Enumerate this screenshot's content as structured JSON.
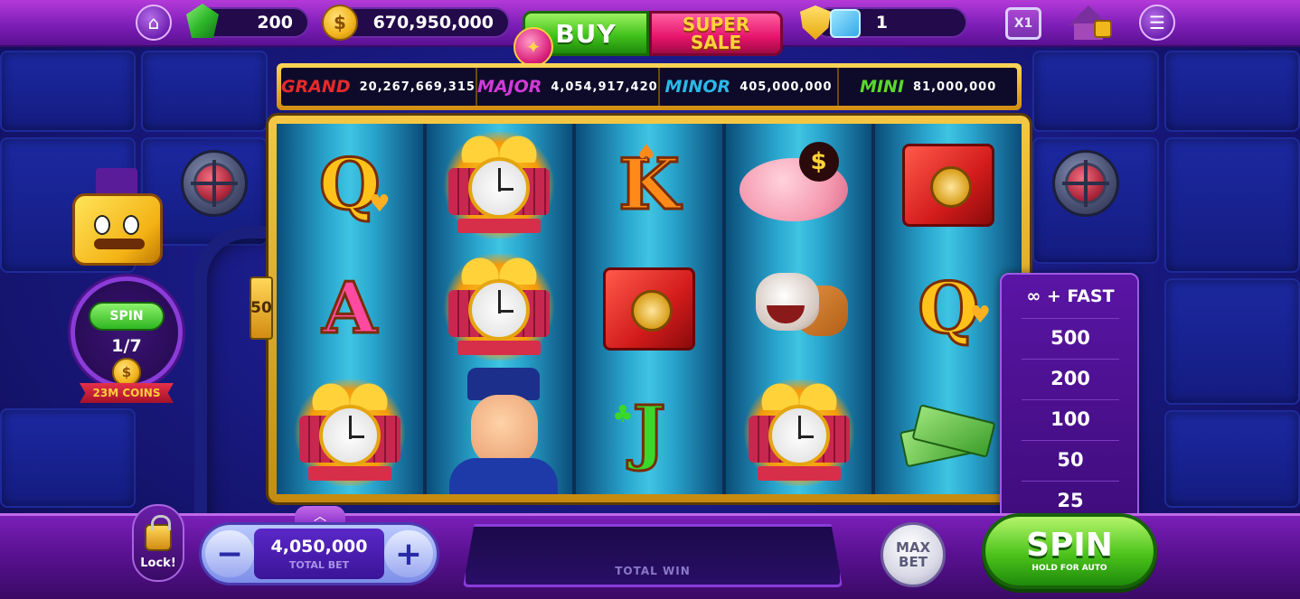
{
  "topbar": {
    "gems": "200",
    "coins": "670,950,000",
    "buy_label": "BUY",
    "sale_line1": "SUPER",
    "sale_line2": "SALE",
    "boost_count": "1",
    "multiplier": "X1",
    "icons": [
      "home-icon",
      "gem-icon",
      "coin-icon",
      "gift-icon",
      "shield-icon",
      "snowflake-icon",
      "multiplier-icon",
      "locked-house-icon",
      "menu-icon"
    ]
  },
  "jackpots": [
    {
      "name": "GRAND",
      "value": "20,267,669,315",
      "color": "#e82a2a"
    },
    {
      "name": "MAJOR",
      "value": "4,054,917,420",
      "color": "#d23ad8"
    },
    {
      "name": "MINOR",
      "value": "405,000,000",
      "color": "#2ab8e8"
    },
    {
      "name": "MINI",
      "value": "81,000,000",
      "color": "#5ad82a"
    }
  ],
  "reels": [
    [
      "Q",
      "clock",
      "A"
    ],
    [
      "clock",
      "clock",
      "police"
    ],
    [
      "K",
      "safe",
      "J"
    ],
    [
      "piggy-bank",
      "bulldog",
      "clock"
    ],
    [
      "safe",
      "Q",
      "money"
    ]
  ],
  "left_bonus": {
    "spin_label": "SPIN",
    "progress": "1/7",
    "reward": "23M COINS",
    "side_value": "50"
  },
  "auto_menu": {
    "header": "∞ + FAST",
    "options": [
      "500",
      "200",
      "100",
      "50",
      "25"
    ]
  },
  "bottombar": {
    "lock_label": "Lock!",
    "bet_value": "4,050,000",
    "bet_label": "TOTAL BET",
    "win_label": "TOTAL WIN",
    "maxbet_label": "MAX BET",
    "spin_label": "SPIN",
    "spin_sub": "HOLD FOR AUTO"
  },
  "colors": {
    "accent_purple": "#7e1eb8",
    "spin_green": "#41c21c",
    "sale_pink": "#e5136b",
    "gold": "#f5c743"
  }
}
